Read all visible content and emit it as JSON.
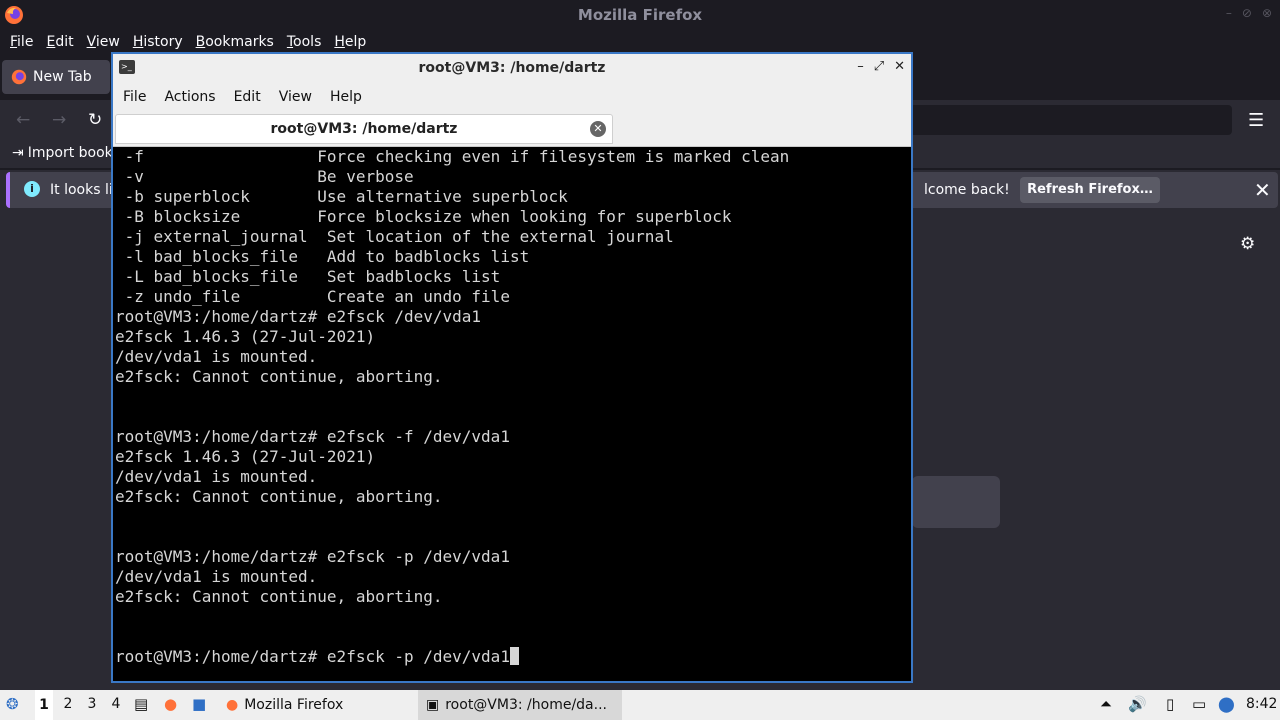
{
  "firefox": {
    "window_title": "Mozilla Firefox",
    "menu": [
      "File",
      "Edit",
      "View",
      "History",
      "Bookmarks",
      "Tools",
      "Help"
    ],
    "tab_label": "New Tab",
    "import_bookmarks": "Import book",
    "notification": {
      "text_left": "It looks lik",
      "text_right": "lcome back!",
      "button": "Refresh Firefox…"
    }
  },
  "terminal": {
    "window_title": "root@VM3: /home/dartz",
    "menu": [
      "File",
      "Actions",
      "Edit",
      "View",
      "Help"
    ],
    "tab_label": "root@VM3: /home/dartz",
    "lines": [
      " -f                  Force checking even if filesystem is marked clean",
      " -v                  Be verbose",
      " -b superblock       Use alternative superblock",
      " -B blocksize        Force blocksize when looking for superblock",
      " -j external_journal  Set location of the external journal",
      " -l bad_blocks_file   Add to badblocks list",
      " -L bad_blocks_file   Set badblocks list",
      " -z undo_file         Create an undo file",
      "root@VM3:/home/dartz# e2fsck /dev/vda1",
      "e2fsck 1.46.3 (27-Jul-2021)",
      "/dev/vda1 is mounted.",
      "e2fsck: Cannot continue, aborting.",
      "",
      "",
      "root@VM3:/home/dartz# e2fsck -f /dev/vda1",
      "e2fsck 1.46.3 (27-Jul-2021)",
      "/dev/vda1 is mounted.",
      "e2fsck: Cannot continue, aborting.",
      "",
      "",
      "root@VM3:/home/dartz# e2fsck -p /dev/vda1",
      "/dev/vda1 is mounted.",
      "e2fsck: Cannot continue, aborting.",
      "",
      ""
    ],
    "prompt_line": "root@VM3:/home/dartz# e2fsck -p /dev/vda1"
  },
  "taskbar": {
    "workspaces": [
      "1",
      "2",
      "3",
      "4"
    ],
    "tasks": [
      {
        "label": "Mozilla Firefox",
        "icon": "firefox-icon"
      },
      {
        "label": "root@VM3: /home/da...",
        "icon": "terminal-icon"
      }
    ],
    "clock": "8:42"
  }
}
